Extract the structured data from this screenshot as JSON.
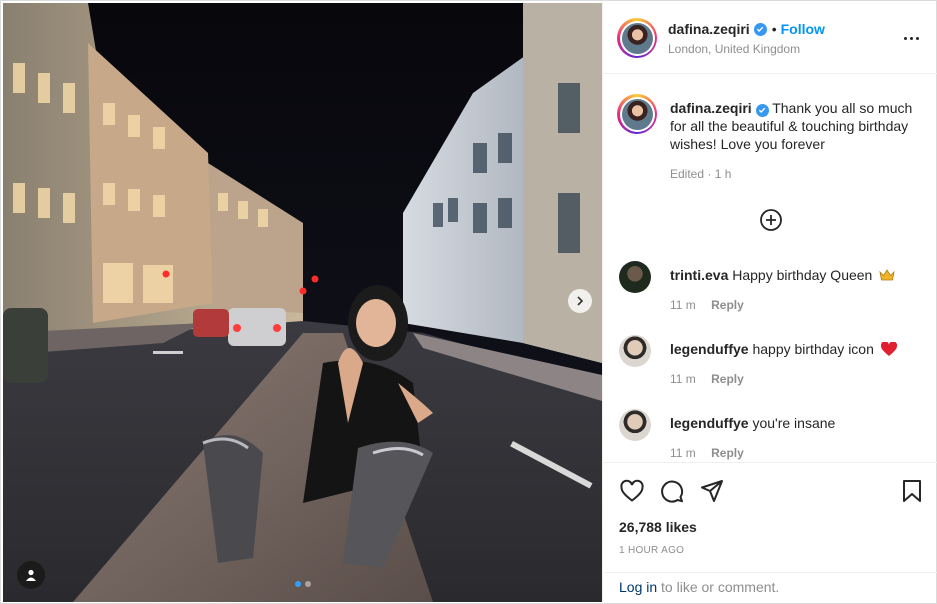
{
  "post": {
    "author": {
      "username": "dafina.zeqiri",
      "follow_separator": "•",
      "follow_label": "Follow",
      "location": "London, United Kingdom"
    },
    "caption": {
      "username": "dafina.zeqiri",
      "text": "Thank you all so much for all the beautiful & touching birthday wishes! Love you forever",
      "edited": "Edited · 1 h"
    },
    "comments": [
      {
        "username": "trinti.eva",
        "text": "Happy birthday Queen",
        "emoji": "crown",
        "time": "11 m",
        "reply_label": "Reply",
        "avatar_color": "#2b2f2a"
      },
      {
        "username": "legenduffye",
        "text": "happy birthday icon",
        "emoji": "red-heart",
        "time": "11 m",
        "reply_label": "Reply",
        "avatar_color": "#d8cfc8"
      },
      {
        "username": "legenduffye",
        "text": "you're insane",
        "emoji": "",
        "time": "11 m",
        "reply_label": "Reply",
        "avatar_color": "#d8cfc8"
      }
    ],
    "likes": "26,788 likes",
    "time_ago": "1 HOUR AGO",
    "login_prompt": {
      "link": "Log in",
      "rest": " to like or comment."
    },
    "carousel": {
      "slides": 2,
      "active": 1
    }
  },
  "icons": {
    "verified": "verified-badge-icon",
    "more": "more-options-icon",
    "load_more": "plus-circle-icon",
    "like": "heart-icon",
    "comment": "comment-icon",
    "share": "share-icon",
    "save": "bookmark-icon",
    "tag": "user-tag-icon",
    "next": "chevron-right-icon"
  },
  "colors": {
    "accent": "#0095f6",
    "verified": "#3897f0",
    "muted": "#8e8e8e",
    "text": "#262626"
  }
}
